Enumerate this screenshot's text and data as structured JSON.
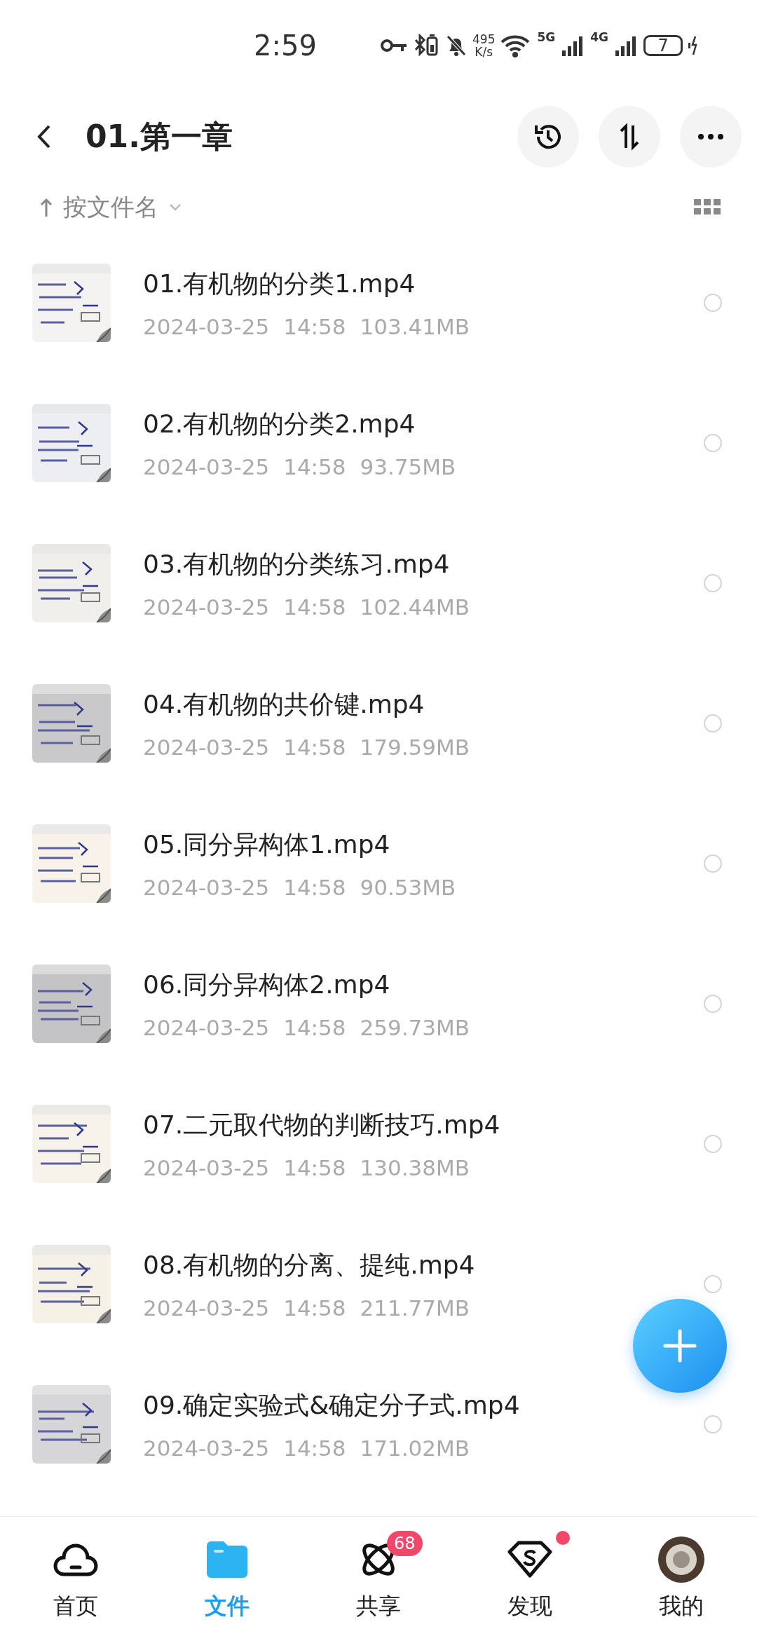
{
  "status_bar": {
    "time": "2:59",
    "speed_value": "495",
    "speed_unit": "K/s",
    "network_1": "5G",
    "network_2": "4G",
    "battery": "7"
  },
  "header": {
    "title": "01.第一章"
  },
  "sort": {
    "label": "按文件名"
  },
  "files": [
    {
      "name": "01.有机物的分类1.mp4",
      "date": "2024-03-25",
      "time": "14:58",
      "size": "103.41MB",
      "selected": false
    },
    {
      "name": "02.有机物的分类2.mp4",
      "date": "2024-03-25",
      "time": "14:58",
      "size": "93.75MB",
      "selected": false
    },
    {
      "name": "03.有机物的分类练习.mp4",
      "date": "2024-03-25",
      "time": "14:58",
      "size": "102.44MB",
      "selected": false
    },
    {
      "name": "04.有机物的共价键.mp4",
      "date": "2024-03-25",
      "time": "14:58",
      "size": "179.59MB",
      "selected": false
    },
    {
      "name": "05.同分异构体1.mp4",
      "date": "2024-03-25",
      "time": "14:58",
      "size": "90.53MB",
      "selected": false
    },
    {
      "name": "06.同分异构体2.mp4",
      "date": "2024-03-25",
      "time": "14:58",
      "size": "259.73MB",
      "selected": false
    },
    {
      "name": "07.二元取代物的判断技巧.mp4",
      "date": "2024-03-25",
      "time": "14:58",
      "size": "130.38MB",
      "selected": false
    },
    {
      "name": "08.有机物的分离、提纯.mp4",
      "date": "2024-03-25",
      "time": "14:58",
      "size": "211.77MB",
      "selected": false
    },
    {
      "name": "09.确定实验式&确定分子式.mp4",
      "date": "2024-03-25",
      "time": "14:58",
      "size": "171.02MB",
      "selected": false
    }
  ],
  "nav": [
    {
      "kind": "home",
      "label": "首页",
      "selected": false
    },
    {
      "kind": "files",
      "label": "文件",
      "selected": true
    },
    {
      "kind": "share",
      "label": "共享",
      "selected": false,
      "badge": "68"
    },
    {
      "kind": "discover",
      "label": "发现",
      "selected": false,
      "dot": true
    },
    {
      "kind": "me",
      "label": "我的",
      "selected": false
    }
  ]
}
